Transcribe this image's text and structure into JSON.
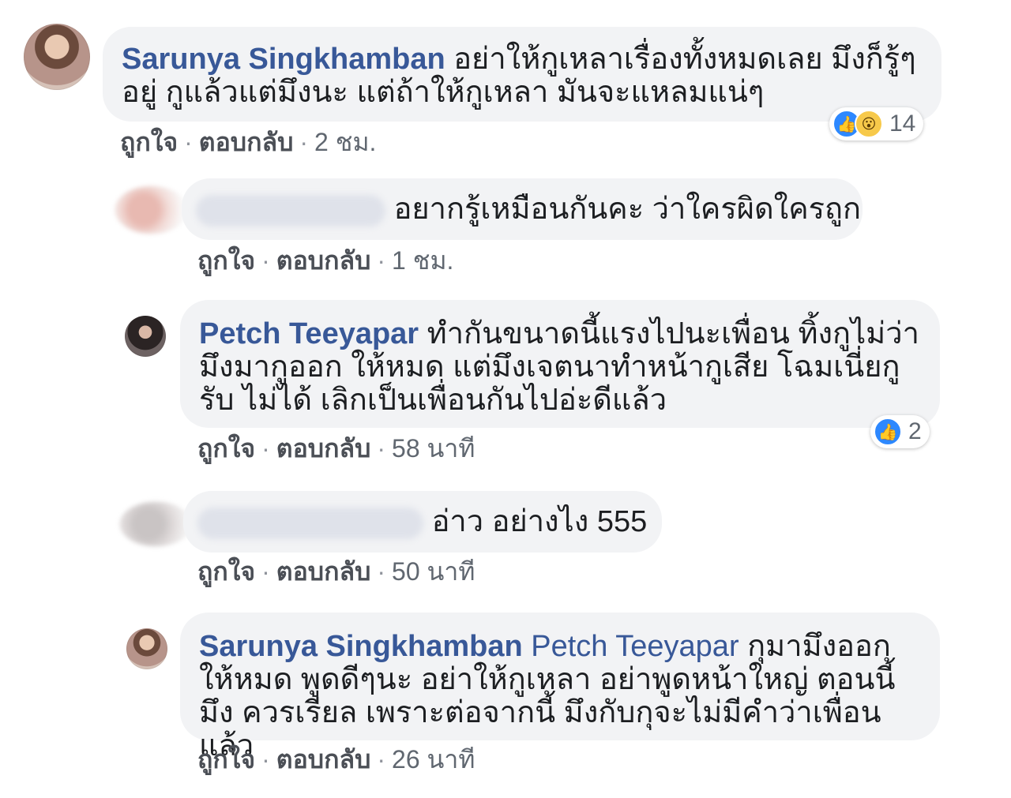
{
  "comments": [
    {
      "name": "Sarunya Singkhamban",
      "text": "อย่าให้กูเหลาเรื่องทั้งหมดเลย มึงก็รู้ๆ อยู่ กูแล้วแต่มึงนะ แต่ถ้าให้กูเหลา มันจะแหลมแน่ๆ",
      "like": "ถูกใจ",
      "reply": "ตอบกลับ",
      "time": "2 ชม.",
      "reaction_count": "14"
    },
    {
      "text": "อยากรู้เหมือนกันคะ ว่าใครผิดใครถูก",
      "like": "ถูกใจ",
      "reply": "ตอบกลับ",
      "time": "1 ชม."
    },
    {
      "name": "Petch Teeyapar",
      "text": "ทำกันขนาดนี้แรงไปนะเพื่อน ทิ้งกูไม่ว่า มึงมากูออก ให้หมด แต่มึงเจตนาทำหน้ากูเสีย โฉมเนี่ยกูรับ ไม่ได้ เลิกเป็นเพื่อนกันไปอ่ะดีแล้ว",
      "like": "ถูกใจ",
      "reply": "ตอบกลับ",
      "time": "58 นาที",
      "reaction_count": "2"
    },
    {
      "text": "อ่าว อย่างไง 555",
      "like": "ถูกใจ",
      "reply": "ตอบกลับ",
      "time": "50 นาที"
    },
    {
      "name": "Sarunya Singkhamban",
      "tag": "Petch Teeyapar",
      "text": "กุมามึงออก ให้หมด พูดดีๆนะ อย่าให้กูเหลา อย่าพูดหน้าใหญ่ ตอนนี้มึง ควรเรียล เพราะต่อจากนี้ มึงกับกุจะไม่มีคำว่าเพื่อนแล้ว",
      "like": "ถูกใจ",
      "reply": "ตอบกลับ",
      "time": "26 นาที"
    }
  ],
  "separator": "·",
  "icons": {
    "like": "thumbs-up-icon",
    "wow": "wow-face-icon"
  },
  "colors": {
    "name": "#385898",
    "bubble": "#f2f3f5",
    "like": "#2d88ff"
  }
}
